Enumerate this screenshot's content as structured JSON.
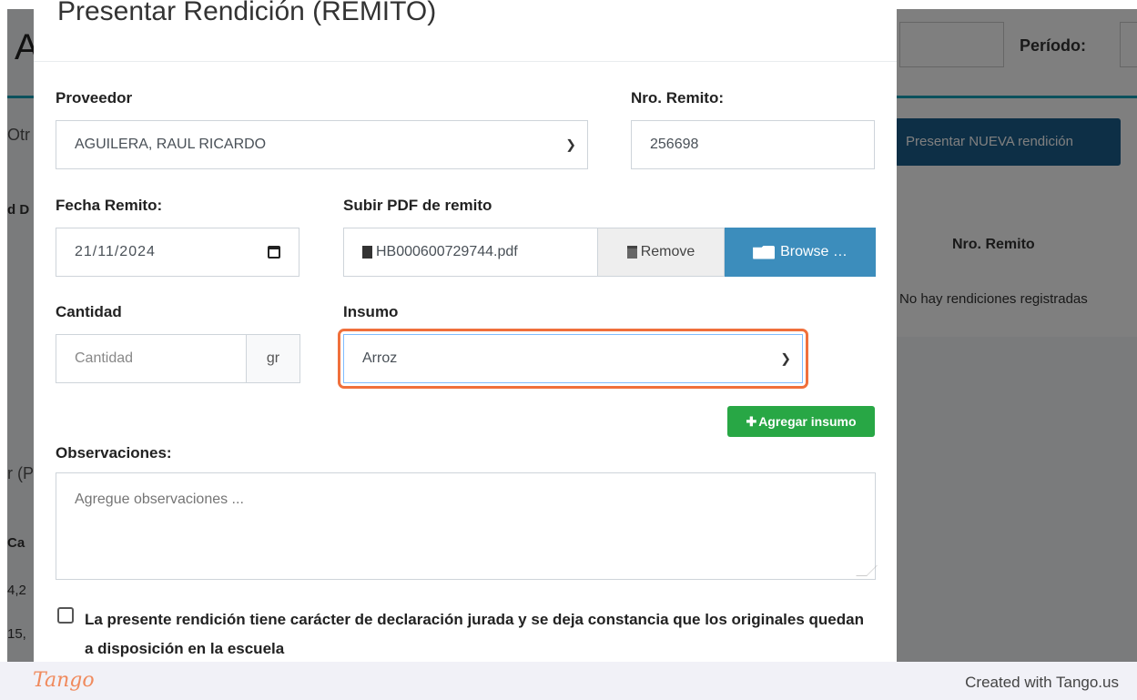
{
  "background": {
    "title_fragment": "A",
    "otro_fragment": "Otr",
    "d_fragment": "d D",
    "p_fragment": "r (P",
    "ca_fragment": "Ca",
    "n1_fragment": "4,2",
    "n2_fragment": "15,",
    "periodo_label": "Período:",
    "nueva_button": "Presentar NUEVA rendición",
    "nro_remito_header": "Nro. Remito",
    "empty_text": "No hay rendiciones registradas"
  },
  "modal": {
    "title": "Presentar Rendición (REMITO)",
    "proveedor_label": "Proveedor",
    "proveedor_value": "AGUILERA, RAUL RICARDO",
    "nro_remito_label": "Nro. Remito:",
    "nro_remito_value": "256698",
    "fecha_label": "Fecha Remito:",
    "fecha_value": "21/11/2024",
    "subir_label": "Subir PDF de remito",
    "file_name": "HB000600729744.pdf",
    "remove_label": "Remove",
    "browse_label": "Browse …",
    "cantidad_label": "Cantidad",
    "cantidad_placeholder": "Cantidad",
    "unit": "gr",
    "insumo_label": "Insumo",
    "insumo_value": "Arroz",
    "agregar_label": "Agregar insumo",
    "observaciones_label": "Observaciones:",
    "observaciones_placeholder": "Agregue observaciones ...",
    "declaracion_text": "La presente rendición tiene carácter de declaración jurada y se deja constancia que los originales quedan a disposición en la escuela"
  },
  "footer": {
    "logo": "Tango",
    "created": "Created with Tango.us"
  },
  "colors": {
    "accent_highlight": "#f0703c",
    "browse_button": "#3c8dbc",
    "agregar_button": "#28a745",
    "nueva_button": "#1b5f8c"
  }
}
